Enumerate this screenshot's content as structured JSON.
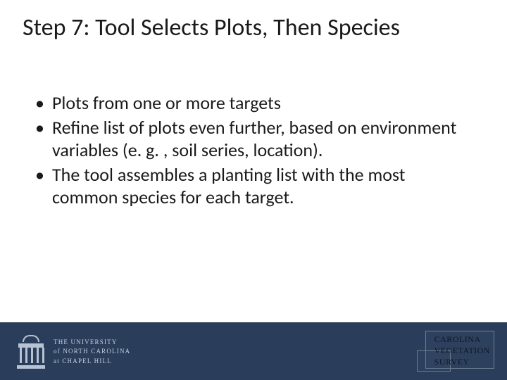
{
  "title": "Step 7: Tool Selects Plots, Then Species",
  "bullets": [
    "Plots from one or more targets",
    "Refine list of plots even further, based on environment variables (e. g. , soil series, location).",
    "The tool assembles a planting list with the most common species for each target."
  ],
  "footer": {
    "unc_line1": "THE UNIVERSITY",
    "unc_line2": "of NORTH CAROLINA",
    "unc_line3": "at CHAPEL HILL",
    "cvs_line1": "CAROLINA",
    "cvs_line2": "VEGETATION",
    "cvs_line3": "SURVEY"
  }
}
